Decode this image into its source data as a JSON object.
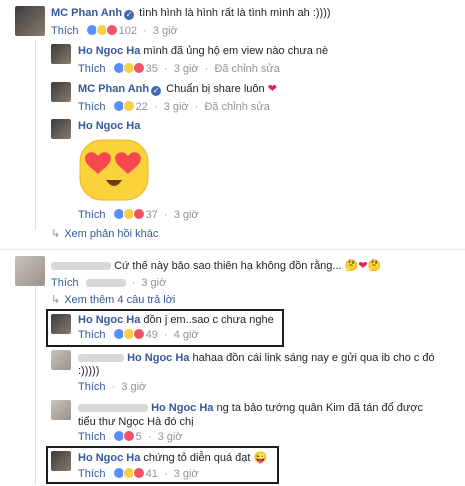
{
  "comments": [
    {
      "name": "MC Phan Anh",
      "text": "tình hình là hình rất là tình mình ah :))))",
      "like": "Thích",
      "count": "102",
      "time": "3 giờ"
    },
    {
      "name": "Ho Ngoc Ha",
      "text": "mình đã ủng hộ em view nào chưa nè",
      "like": "Thích",
      "count": "35",
      "time": "3 giờ",
      "edited": "Đã chỉnh sửa"
    },
    {
      "name": "MC Phan Anh",
      "text": "Chuẩn bị share luôn",
      "like": "Thích",
      "count": "22",
      "time": "3 giờ",
      "edited": "Đã chỉnh sửa"
    },
    {
      "name": "Ho Ngoc Ha",
      "like": "Thích",
      "count": "37",
      "time": "3 giờ"
    }
  ],
  "more_replies_1": "Xem phản hồi khác",
  "comment_main": {
    "text": "Cứ thế này bảo sao thiên hạ không đồn rằng...",
    "like": "Thích",
    "time": "3 giờ"
  },
  "more_replies_2": "Xem thêm 4 câu trả lời",
  "replies": [
    {
      "name": "Ho Ngoc Ha",
      "text": "đồn j em..sao c chưa nghe",
      "like": "Thích",
      "count": "49",
      "time": "4 giờ"
    },
    {
      "mention": "Ho Ngoc Ha",
      "text": "hahaa đồn cái link sáng nay e gửi qua ib cho c đó",
      "text2": ":)))))",
      "like": "Thích",
      "time": "3 giờ"
    },
    {
      "mention": "Ho Ngoc Ha",
      "text": "ng ta bảo tướng quân Kim đã tán đổ được",
      "text2": "tiểu thư Ngọc Hà đó chị",
      "like": "Thích",
      "count": "5",
      "time": "3 giờ"
    },
    {
      "name": "Ho Ngoc Ha",
      "text": "chứng tỏ diễn quá đạt",
      "like": "Thích",
      "count": "41",
      "time": "3 giờ"
    }
  ],
  "sep": "·",
  "verified_mark": "✓"
}
